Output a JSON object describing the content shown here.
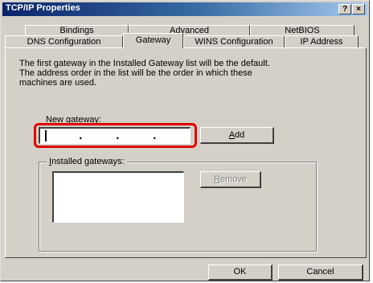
{
  "window": {
    "title": "TCP/IP Properties",
    "help_button": "?",
    "close_button": "×"
  },
  "tabs": {
    "row1": [
      "Bindings",
      "Advanced",
      "NetBIOS"
    ],
    "row2": [
      "DNS Configuration",
      "Gateway",
      "WINS Configuration",
      "IP Address"
    ],
    "active": "Gateway"
  },
  "gateway_tab": {
    "description_lines": [
      "The first gateway in the Installed Gateway list will be the default.",
      "The address order in the list will be the order in which these",
      "machines are used."
    ],
    "new_gateway_label": "New gateway:",
    "new_gateway_value": {
      "octets": [
        "",
        "",
        "",
        ""
      ],
      "separators": [
        ".",
        ".",
        "."
      ]
    },
    "add_button": {
      "access_key": "A",
      "rest": "dd"
    },
    "installed_label": {
      "access_key": "I",
      "rest": "nstalled gateways:"
    },
    "remove_button": {
      "access_key": "R",
      "rest": "emove",
      "enabled": false
    },
    "installed_gateways": []
  },
  "footer": {
    "ok_label": "OK",
    "cancel_label": "Cancel"
  },
  "colors": {
    "dialog_bg": "#d4d0c8",
    "title_gradient_start": "#0a246a",
    "title_gradient_end": "#a6caf0",
    "highlight_outline": "#e00000"
  }
}
